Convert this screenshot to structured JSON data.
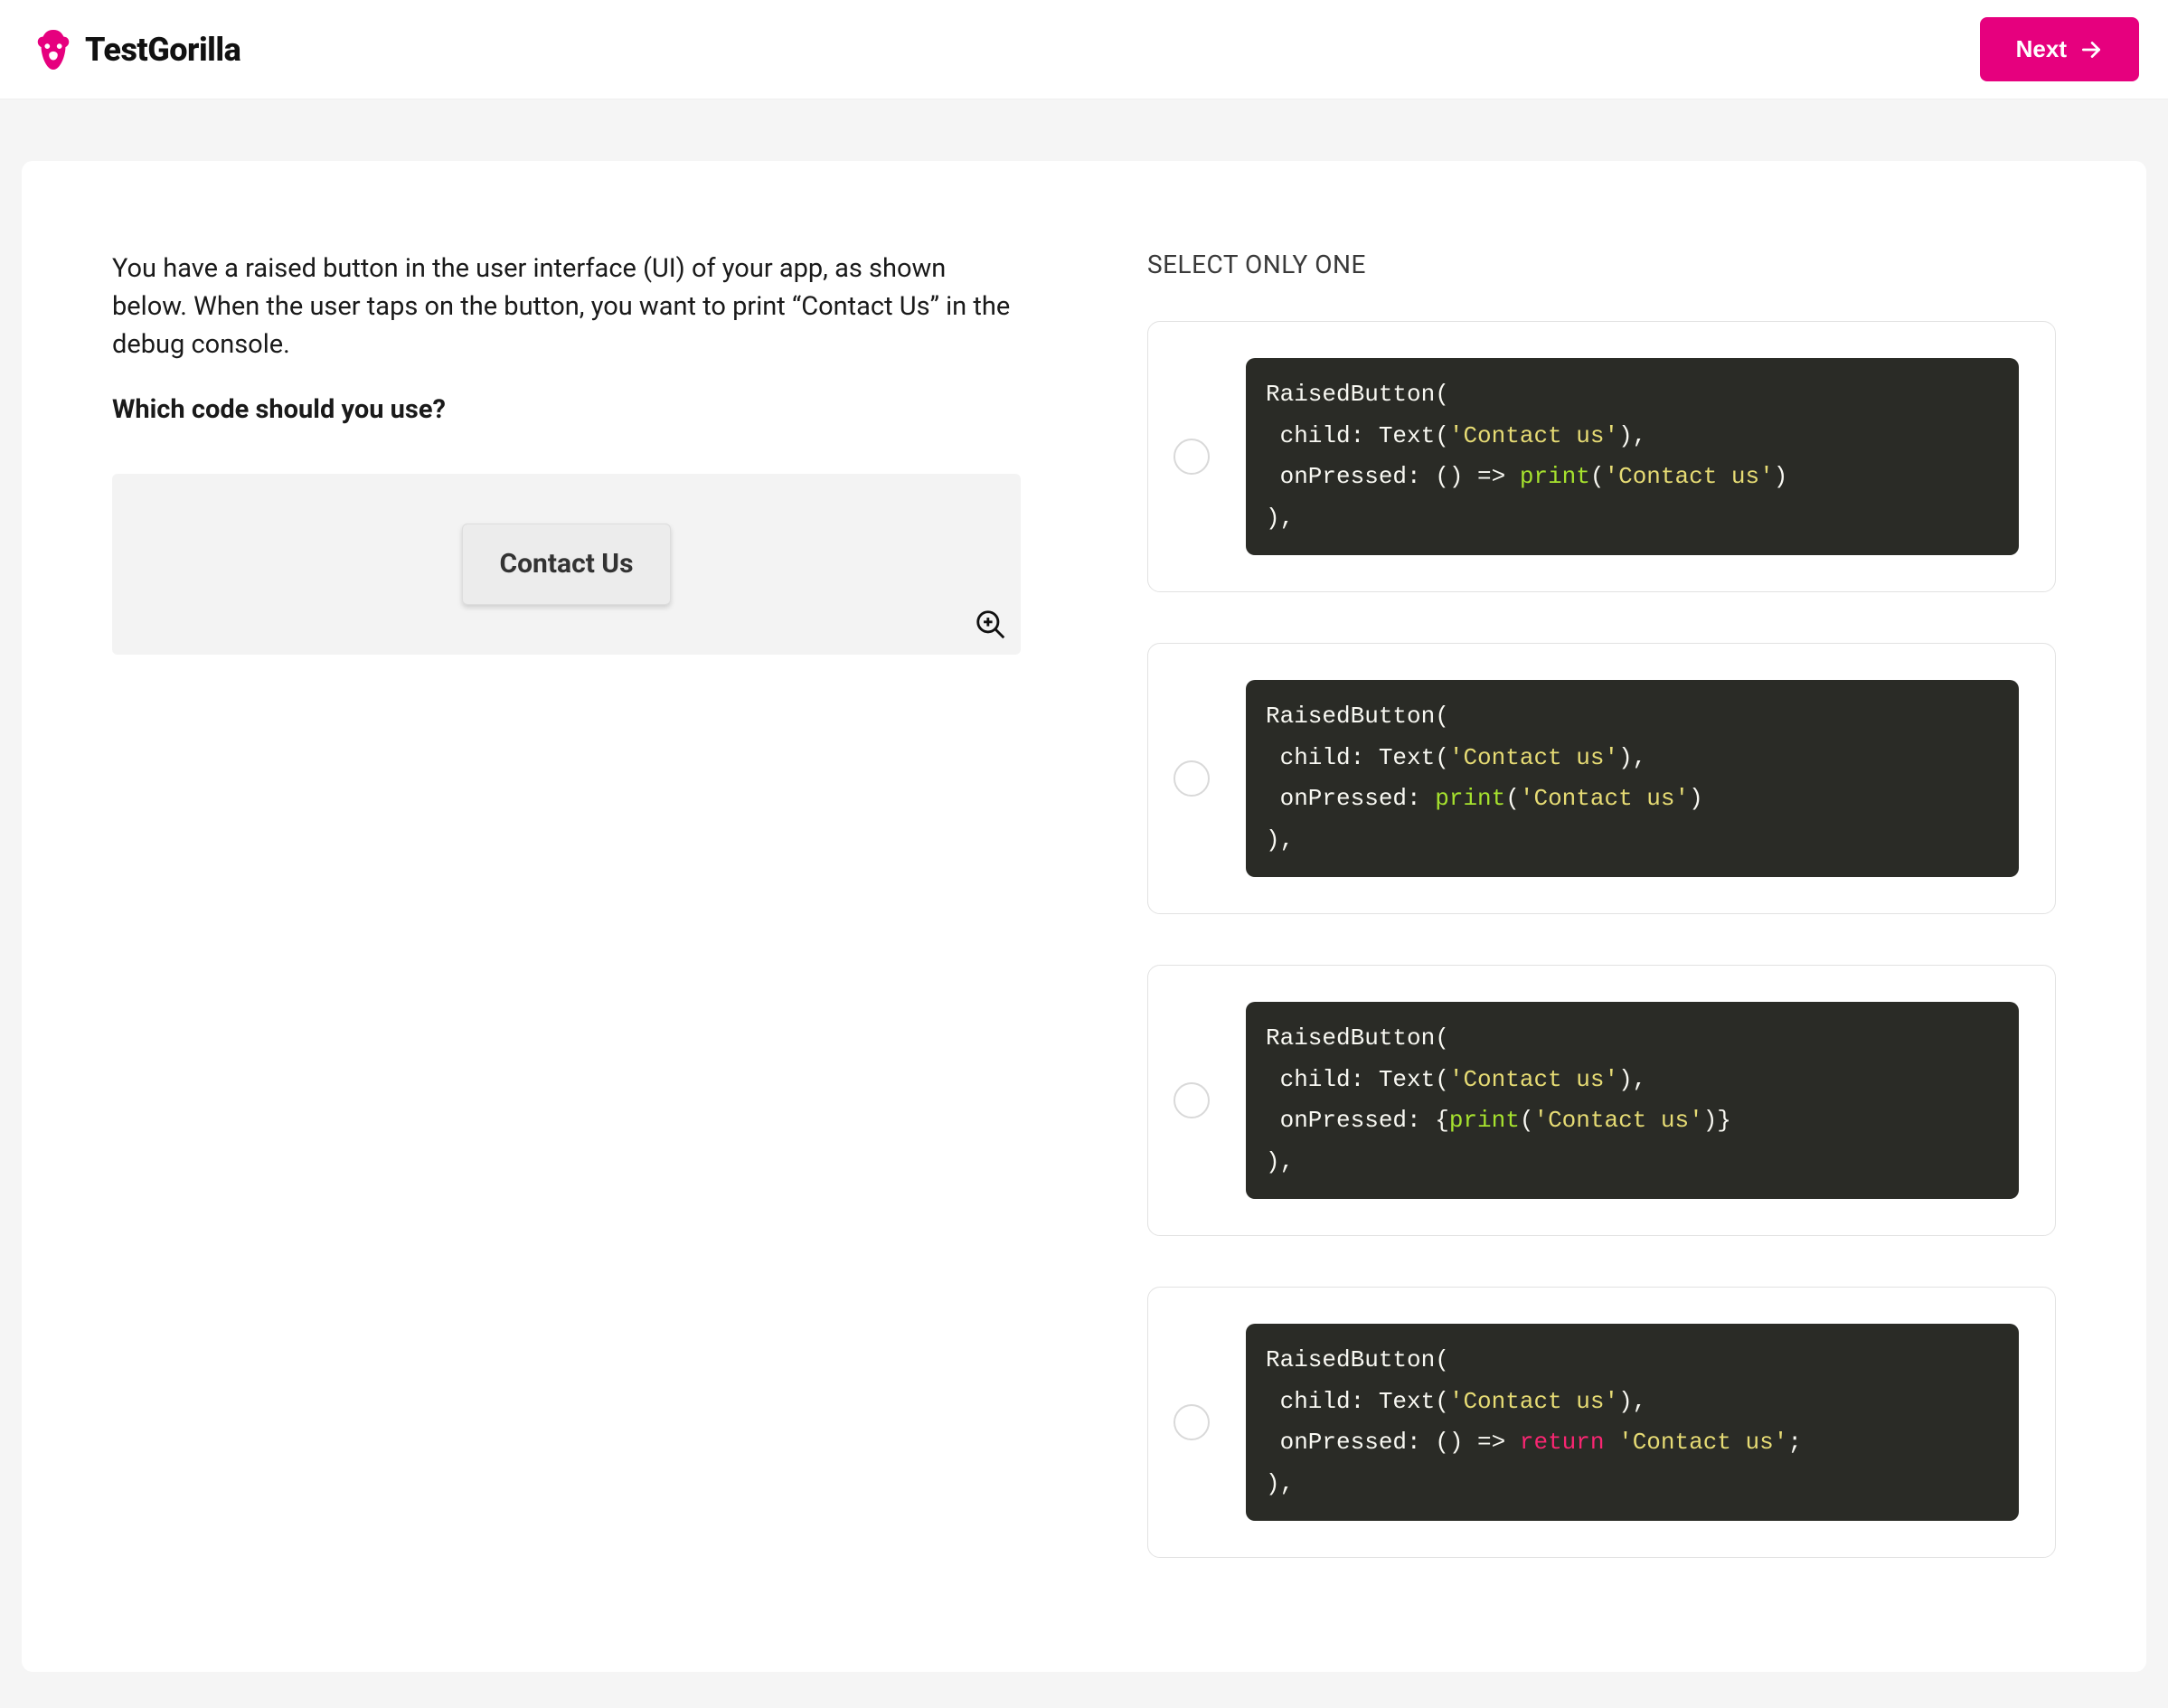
{
  "header": {
    "brand": "TestGorilla",
    "next_label": "Next"
  },
  "question": {
    "text": "You have a raised button in the user interface (UI) of your app, as shown below. When the user taps on the button, you want to print “Contact Us” in the debug console.",
    "prompt": "Which code should you use?",
    "image_button_label": "Contact Us"
  },
  "answers": {
    "heading": "SELECT ONLY ONE",
    "options": [
      {
        "tokens": [
          [
            "plain",
            "RaisedButton(\n"
          ],
          [
            "plain",
            " child: Text("
          ],
          [
            "str",
            "'Contact us'"
          ],
          [
            "plain",
            "),\n"
          ],
          [
            "plain",
            " onPressed: () => "
          ],
          [
            "fn",
            "print"
          ],
          [
            "plain",
            "("
          ],
          [
            "str",
            "'Contact us'"
          ],
          [
            "plain",
            ")\n"
          ],
          [
            "plain",
            "),"
          ]
        ]
      },
      {
        "tokens": [
          [
            "plain",
            "RaisedButton(\n"
          ],
          [
            "plain",
            " child: Text("
          ],
          [
            "str",
            "'Contact us'"
          ],
          [
            "plain",
            "),\n"
          ],
          [
            "plain",
            " onPressed: "
          ],
          [
            "fn",
            "print"
          ],
          [
            "plain",
            "("
          ],
          [
            "str",
            "'Contact us'"
          ],
          [
            "plain",
            ")\n"
          ],
          [
            "plain",
            "),"
          ]
        ]
      },
      {
        "tokens": [
          [
            "plain",
            "RaisedButton(\n"
          ],
          [
            "plain",
            " child: Text("
          ],
          [
            "str",
            "'Contact us'"
          ],
          [
            "plain",
            "),\n"
          ],
          [
            "plain",
            " onPressed: {"
          ],
          [
            "fn",
            "print"
          ],
          [
            "plain",
            "("
          ],
          [
            "str",
            "'Contact us'"
          ],
          [
            "plain",
            ")}\n"
          ],
          [
            "plain",
            "),"
          ]
        ]
      },
      {
        "tokens": [
          [
            "plain",
            "RaisedButton(\n"
          ],
          [
            "plain",
            " child: Text("
          ],
          [
            "str",
            "'Contact us'"
          ],
          [
            "plain",
            "),\n"
          ],
          [
            "plain",
            " onPressed: () => "
          ],
          [
            "kw",
            "return"
          ],
          [
            "plain",
            " "
          ],
          [
            "str",
            "'Contact us'"
          ],
          [
            "plain",
            ";\n"
          ],
          [
            "plain",
            "),"
          ]
        ]
      }
    ]
  }
}
